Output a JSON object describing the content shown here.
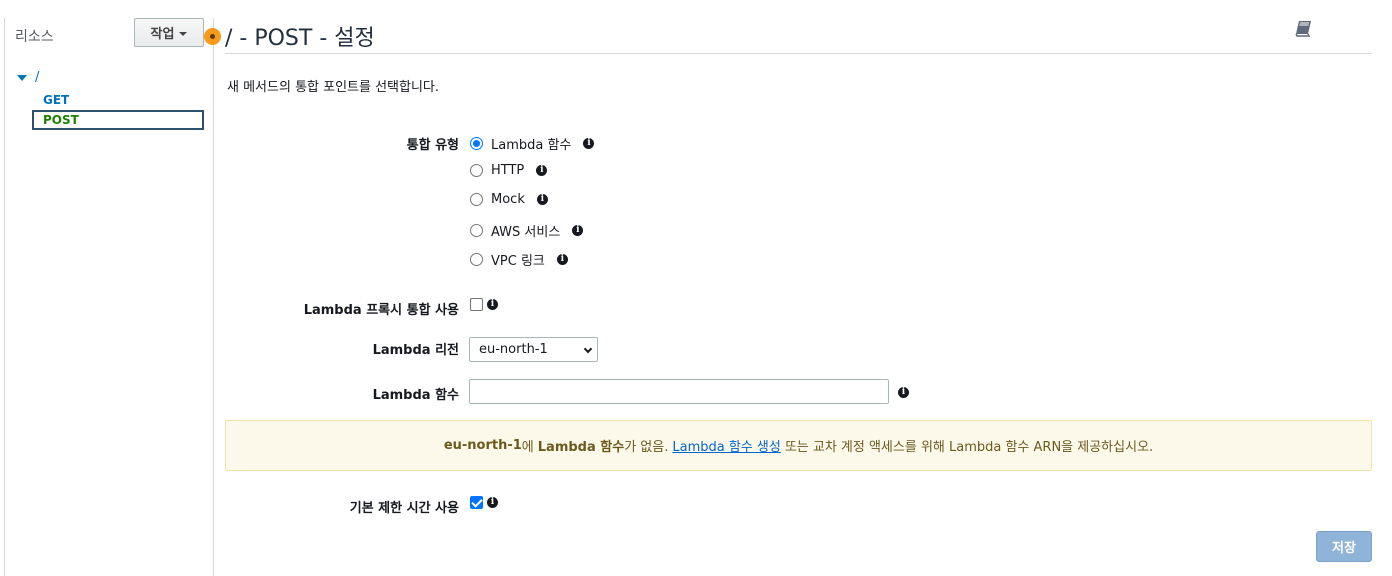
{
  "sidebar": {
    "title": "리소스",
    "actions_label": "작업",
    "tree": {
      "root": "/",
      "get": "GET",
      "post": "POST"
    }
  },
  "main": {
    "title": "/ - POST - 설정",
    "description": "새 메서드의 통합 포인트를 선택합니다.",
    "integration_type": {
      "label": "통합 유형",
      "options": [
        "Lambda 함수",
        "HTTP",
        "Mock",
        "AWS 서비스",
        "VPC 링크"
      ],
      "selected": "Lambda 함수"
    },
    "proxy": {
      "label": "Lambda 프록시 통합 사용",
      "checked": false
    },
    "region": {
      "label": "Lambda 리전",
      "value": "eu-north-1"
    },
    "function": {
      "label": "Lambda 함수",
      "value": ""
    },
    "alert": {
      "region": "eu-north-1",
      "text_1": "에",
      "bold": "Lambda 함수",
      "text_2": "가 없음.",
      "link": "Lambda 함수 생성",
      "text_3": "또는 교차 계정 액세스를 위해 Lambda 함수 ARN을 제공하십시오."
    },
    "timeout": {
      "label": "기본 제한 시간 사용",
      "checked": true
    },
    "save_label": "저장"
  },
  "icons": {
    "info": "i",
    "book": "book-icon"
  },
  "colors": {
    "accent": "#0073bb",
    "selected_resource": "#1d8102",
    "resize_dot": "#f89a1c",
    "alert_bg": "#fdf9ea"
  }
}
